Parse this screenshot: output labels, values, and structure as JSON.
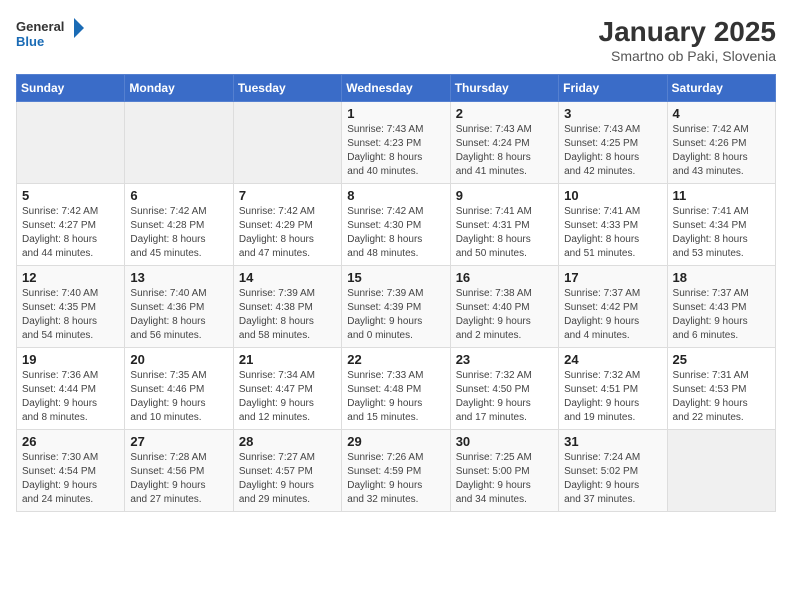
{
  "logo": {
    "line1": "General",
    "line2": "Blue"
  },
  "title": "January 2025",
  "subtitle": "Smartno ob Paki, Slovenia",
  "headers": [
    "Sunday",
    "Monday",
    "Tuesday",
    "Wednesday",
    "Thursday",
    "Friday",
    "Saturday"
  ],
  "weeks": [
    [
      {
        "day": "",
        "info": ""
      },
      {
        "day": "",
        "info": ""
      },
      {
        "day": "",
        "info": ""
      },
      {
        "day": "1",
        "info": "Sunrise: 7:43 AM\nSunset: 4:23 PM\nDaylight: 8 hours\nand 40 minutes."
      },
      {
        "day": "2",
        "info": "Sunrise: 7:43 AM\nSunset: 4:24 PM\nDaylight: 8 hours\nand 41 minutes."
      },
      {
        "day": "3",
        "info": "Sunrise: 7:43 AM\nSunset: 4:25 PM\nDaylight: 8 hours\nand 42 minutes."
      },
      {
        "day": "4",
        "info": "Sunrise: 7:42 AM\nSunset: 4:26 PM\nDaylight: 8 hours\nand 43 minutes."
      }
    ],
    [
      {
        "day": "5",
        "info": "Sunrise: 7:42 AM\nSunset: 4:27 PM\nDaylight: 8 hours\nand 44 minutes."
      },
      {
        "day": "6",
        "info": "Sunrise: 7:42 AM\nSunset: 4:28 PM\nDaylight: 8 hours\nand 45 minutes."
      },
      {
        "day": "7",
        "info": "Sunrise: 7:42 AM\nSunset: 4:29 PM\nDaylight: 8 hours\nand 47 minutes."
      },
      {
        "day": "8",
        "info": "Sunrise: 7:42 AM\nSunset: 4:30 PM\nDaylight: 8 hours\nand 48 minutes."
      },
      {
        "day": "9",
        "info": "Sunrise: 7:41 AM\nSunset: 4:31 PM\nDaylight: 8 hours\nand 50 minutes."
      },
      {
        "day": "10",
        "info": "Sunrise: 7:41 AM\nSunset: 4:33 PM\nDaylight: 8 hours\nand 51 minutes."
      },
      {
        "day": "11",
        "info": "Sunrise: 7:41 AM\nSunset: 4:34 PM\nDaylight: 8 hours\nand 53 minutes."
      }
    ],
    [
      {
        "day": "12",
        "info": "Sunrise: 7:40 AM\nSunset: 4:35 PM\nDaylight: 8 hours\nand 54 minutes."
      },
      {
        "day": "13",
        "info": "Sunrise: 7:40 AM\nSunset: 4:36 PM\nDaylight: 8 hours\nand 56 minutes."
      },
      {
        "day": "14",
        "info": "Sunrise: 7:39 AM\nSunset: 4:38 PM\nDaylight: 8 hours\nand 58 minutes."
      },
      {
        "day": "15",
        "info": "Sunrise: 7:39 AM\nSunset: 4:39 PM\nDaylight: 9 hours\nand 0 minutes."
      },
      {
        "day": "16",
        "info": "Sunrise: 7:38 AM\nSunset: 4:40 PM\nDaylight: 9 hours\nand 2 minutes."
      },
      {
        "day": "17",
        "info": "Sunrise: 7:37 AM\nSunset: 4:42 PM\nDaylight: 9 hours\nand 4 minutes."
      },
      {
        "day": "18",
        "info": "Sunrise: 7:37 AM\nSunset: 4:43 PM\nDaylight: 9 hours\nand 6 minutes."
      }
    ],
    [
      {
        "day": "19",
        "info": "Sunrise: 7:36 AM\nSunset: 4:44 PM\nDaylight: 9 hours\nand 8 minutes."
      },
      {
        "day": "20",
        "info": "Sunrise: 7:35 AM\nSunset: 4:46 PM\nDaylight: 9 hours\nand 10 minutes."
      },
      {
        "day": "21",
        "info": "Sunrise: 7:34 AM\nSunset: 4:47 PM\nDaylight: 9 hours\nand 12 minutes."
      },
      {
        "day": "22",
        "info": "Sunrise: 7:33 AM\nSunset: 4:48 PM\nDaylight: 9 hours\nand 15 minutes."
      },
      {
        "day": "23",
        "info": "Sunrise: 7:32 AM\nSunset: 4:50 PM\nDaylight: 9 hours\nand 17 minutes."
      },
      {
        "day": "24",
        "info": "Sunrise: 7:32 AM\nSunset: 4:51 PM\nDaylight: 9 hours\nand 19 minutes."
      },
      {
        "day": "25",
        "info": "Sunrise: 7:31 AM\nSunset: 4:53 PM\nDaylight: 9 hours\nand 22 minutes."
      }
    ],
    [
      {
        "day": "26",
        "info": "Sunrise: 7:30 AM\nSunset: 4:54 PM\nDaylight: 9 hours\nand 24 minutes."
      },
      {
        "day": "27",
        "info": "Sunrise: 7:28 AM\nSunset: 4:56 PM\nDaylight: 9 hours\nand 27 minutes."
      },
      {
        "day": "28",
        "info": "Sunrise: 7:27 AM\nSunset: 4:57 PM\nDaylight: 9 hours\nand 29 minutes."
      },
      {
        "day": "29",
        "info": "Sunrise: 7:26 AM\nSunset: 4:59 PM\nDaylight: 9 hours\nand 32 minutes."
      },
      {
        "day": "30",
        "info": "Sunrise: 7:25 AM\nSunset: 5:00 PM\nDaylight: 9 hours\nand 34 minutes."
      },
      {
        "day": "31",
        "info": "Sunrise: 7:24 AM\nSunset: 5:02 PM\nDaylight: 9 hours\nand 37 minutes."
      },
      {
        "day": "",
        "info": ""
      }
    ]
  ]
}
